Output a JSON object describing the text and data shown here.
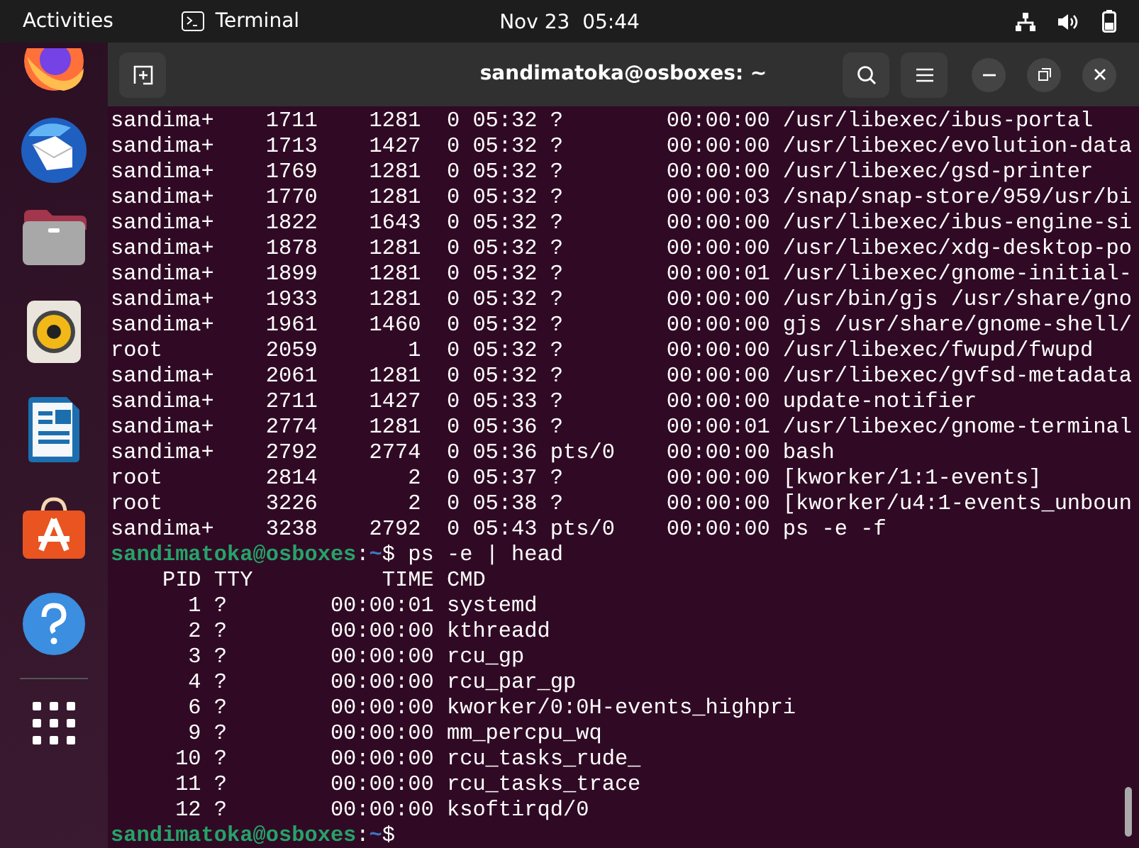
{
  "top_bar": {
    "activities": "Activities",
    "app_name": "Terminal",
    "clock": "Nov 23  05:44"
  },
  "terminal": {
    "title": "sandimatoka@osboxes: ~",
    "lines": [
      {
        "kind": "output",
        "text": "sandima+    1711    1281  0 05:32 ?        00:00:00 /usr/libexec/ibus-portal"
      },
      {
        "kind": "output",
        "text": "sandima+    1713    1427  0 05:32 ?        00:00:00 /usr/libexec/evolution-data"
      },
      {
        "kind": "output",
        "text": "sandima+    1769    1281  0 05:32 ?        00:00:00 /usr/libexec/gsd-printer"
      },
      {
        "kind": "output",
        "text": "sandima+    1770    1281  0 05:32 ?        00:00:03 /snap/snap-store/959/usr/bi"
      },
      {
        "kind": "output",
        "text": "sandima+    1822    1643  0 05:32 ?        00:00:00 /usr/libexec/ibus-engine-si"
      },
      {
        "kind": "output",
        "text": "sandima+    1878    1281  0 05:32 ?        00:00:00 /usr/libexec/xdg-desktop-po"
      },
      {
        "kind": "output",
        "text": "sandima+    1899    1281  0 05:32 ?        00:00:01 /usr/libexec/gnome-initial-"
      },
      {
        "kind": "output",
        "text": "sandima+    1933    1281  0 05:32 ?        00:00:00 /usr/bin/gjs /usr/share/gno"
      },
      {
        "kind": "output",
        "text": "sandima+    1961    1460  0 05:32 ?        00:00:00 gjs /usr/share/gnome-shell/"
      },
      {
        "kind": "output",
        "text": "root        2059       1  0 05:32 ?        00:00:00 /usr/libexec/fwupd/fwupd"
      },
      {
        "kind": "output",
        "text": "sandima+    2061    1281  0 05:32 ?        00:00:00 /usr/libexec/gvfsd-metadata"
      },
      {
        "kind": "output",
        "text": "sandima+    2711    1427  0 05:33 ?        00:00:00 update-notifier"
      },
      {
        "kind": "output",
        "text": "sandima+    2774    1281  0 05:36 ?        00:00:01 /usr/libexec/gnome-terminal"
      },
      {
        "kind": "output",
        "text": "sandima+    2792    2774  0 05:36 pts/0    00:00:00 bash"
      },
      {
        "kind": "output",
        "text": "root        2814       2  0 05:37 ?        00:00:00 [kworker/1:1-events]"
      },
      {
        "kind": "output",
        "text": "root        3226       2  0 05:38 ?        00:00:00 [kworker/u4:1-events_unboun"
      },
      {
        "kind": "output",
        "text": "sandima+    3238    2792  0 05:43 pts/0    00:00:00 ps -e -f"
      },
      {
        "kind": "prompt",
        "user_host": "sandimatoka@osboxes",
        "separator": ":",
        "path": "~",
        "command": "$ ps -e | head"
      },
      {
        "kind": "output",
        "text": "    PID TTY          TIME CMD"
      },
      {
        "kind": "output",
        "text": "      1 ?        00:00:01 systemd"
      },
      {
        "kind": "output",
        "text": "      2 ?        00:00:00 kthreadd"
      },
      {
        "kind": "output",
        "text": "      3 ?        00:00:00 rcu_gp"
      },
      {
        "kind": "output",
        "text": "      4 ?        00:00:00 rcu_par_gp"
      },
      {
        "kind": "output",
        "text": "      6 ?        00:00:00 kworker/0:0H-events_highpri"
      },
      {
        "kind": "output",
        "text": "      9 ?        00:00:00 mm_percpu_wq"
      },
      {
        "kind": "output",
        "text": "     10 ?        00:00:00 rcu_tasks_rude_"
      },
      {
        "kind": "output",
        "text": "     11 ?        00:00:00 rcu_tasks_trace"
      },
      {
        "kind": "output",
        "text": "     12 ?        00:00:00 ksoftirqd/0"
      },
      {
        "kind": "prompt",
        "user_host": "sandimatoka@osboxes",
        "separator": ":",
        "path": "~",
        "command": "$"
      }
    ]
  }
}
